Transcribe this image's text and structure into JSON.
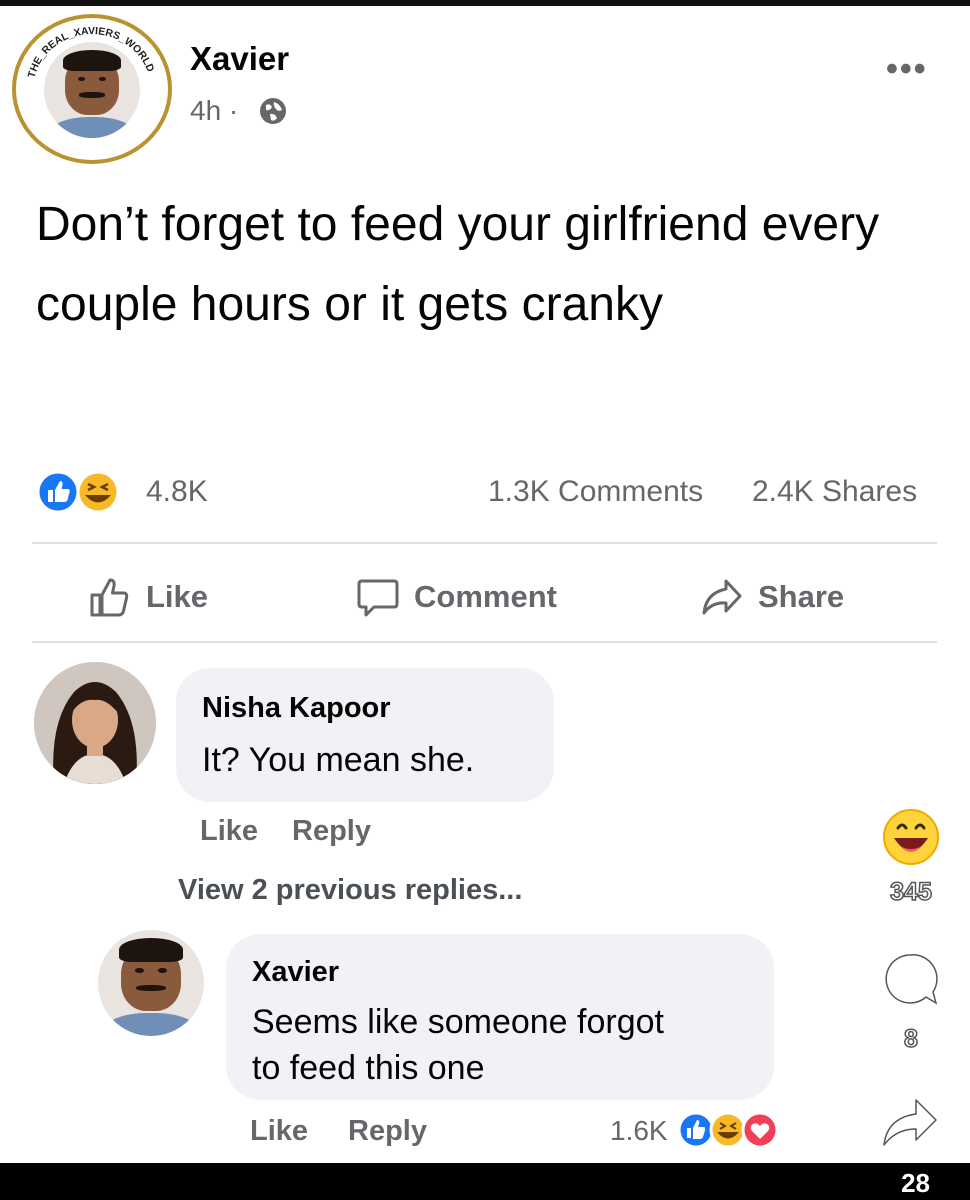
{
  "post": {
    "author": "Xavier",
    "time": "4h ·",
    "avatar_ring_text": "THE_REAL_XAVIERS_WORLD",
    "text": "Don’t forget to feed your girlfriend every couple hours or it gets cranky",
    "reactions_count": "4.8K",
    "comments_count": "1.3K Comments",
    "shares_count": "2.4K Shares",
    "more_label": "•••"
  },
  "actions": {
    "like": "Like",
    "comment": "Comment",
    "share": "Share"
  },
  "comments": [
    {
      "author": "Nisha Kapoor",
      "text": "It? You mean she.",
      "like": "Like",
      "reply": "Reply"
    }
  ],
  "view_previous": "View 2 previous replies...",
  "reply": {
    "author": "Xavier",
    "text_line1": "Seems like someone forgot",
    "text_line2": "to feed this one",
    "like": "Like",
    "reply": "Reply",
    "reaction_count": "1.6K"
  },
  "side": {
    "laugh_count": "345",
    "comment_count": "8"
  },
  "page_number": "28",
  "colors": {
    "like_blue": "#1877f2",
    "text_gray": "#65676b",
    "bubble_bg": "#f0f2f5",
    "ring_gold": "#b8932f",
    "haha_yellow": "#f7b928",
    "love_red": "#f33e58"
  }
}
